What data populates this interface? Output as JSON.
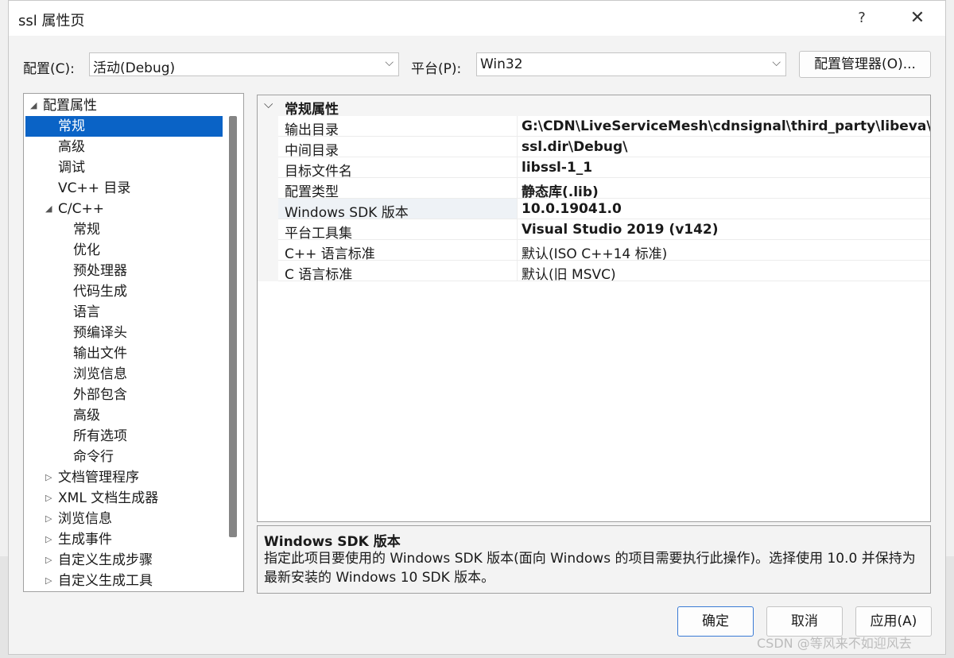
{
  "window": {
    "title": "ssl 属性页",
    "help_icon": "?",
    "close_icon": "✕"
  },
  "config_bar": {
    "config_label": "配置(C):",
    "config_value": "活动(Debug)",
    "platform_label": "平台(P):",
    "platform_value": "Win32",
    "manager_button": "配置管理器(O)..."
  },
  "tree": {
    "items": [
      {
        "label": "配置属性",
        "expander": "◢"
      },
      {
        "label": "常规"
      },
      {
        "label": "高级"
      },
      {
        "label": "调试"
      },
      {
        "label": "VC++ 目录"
      },
      {
        "label": "C/C++",
        "expander": "◢"
      },
      {
        "label": "常规"
      },
      {
        "label": "优化"
      },
      {
        "label": "预处理器"
      },
      {
        "label": "代码生成"
      },
      {
        "label": "语言"
      },
      {
        "label": "预编译头"
      },
      {
        "label": "输出文件"
      },
      {
        "label": "浏览信息"
      },
      {
        "label": "外部包含"
      },
      {
        "label": "高级"
      },
      {
        "label": "所有选项"
      },
      {
        "label": "命令行"
      },
      {
        "label": "文档管理程序",
        "expander": "▷"
      },
      {
        "label": "XML 文档生成器",
        "expander": "▷"
      },
      {
        "label": "浏览信息",
        "expander": "▷"
      },
      {
        "label": "生成事件",
        "expander": "▷"
      },
      {
        "label": "自定义生成步骤",
        "expander": "▷"
      },
      {
        "label": "自定义生成工具",
        "expander": "▷"
      }
    ]
  },
  "grid": {
    "category": "常规属性",
    "properties": [
      {
        "name": "输出目录",
        "value": "G:\\CDN\\LiveServiceMesh\\cdnsignal\\third_party\\libeva\\thi"
      },
      {
        "name": "中间目录",
        "value": "ssl.dir\\Debug\\"
      },
      {
        "name": "目标文件名",
        "value": "libssl-1_1"
      },
      {
        "name": "配置类型",
        "value": "静态库(.lib)"
      },
      {
        "name": "Windows SDK 版本",
        "value": "10.0.19041.0"
      },
      {
        "name": "平台工具集",
        "value": "Visual Studio 2019 (v142)"
      },
      {
        "name": "C++ 语言标准",
        "value": "默认(ISO C++14 标准)"
      },
      {
        "name": "C 语言标准",
        "value": "默认(旧 MSVC)"
      }
    ]
  },
  "description": {
    "title": "Windows SDK 版本",
    "text": "指定此项目要使用的 Windows SDK 版本(面向 Windows 的项目需要执行此操作)。选择使用 10.0 并保持为最新安装的 Windows 10 SDK 版本。"
  },
  "buttons": {
    "ok": "确定",
    "cancel": "取消",
    "apply": "应用(A)"
  },
  "watermark": "CSDN @等风来不如迎风去"
}
